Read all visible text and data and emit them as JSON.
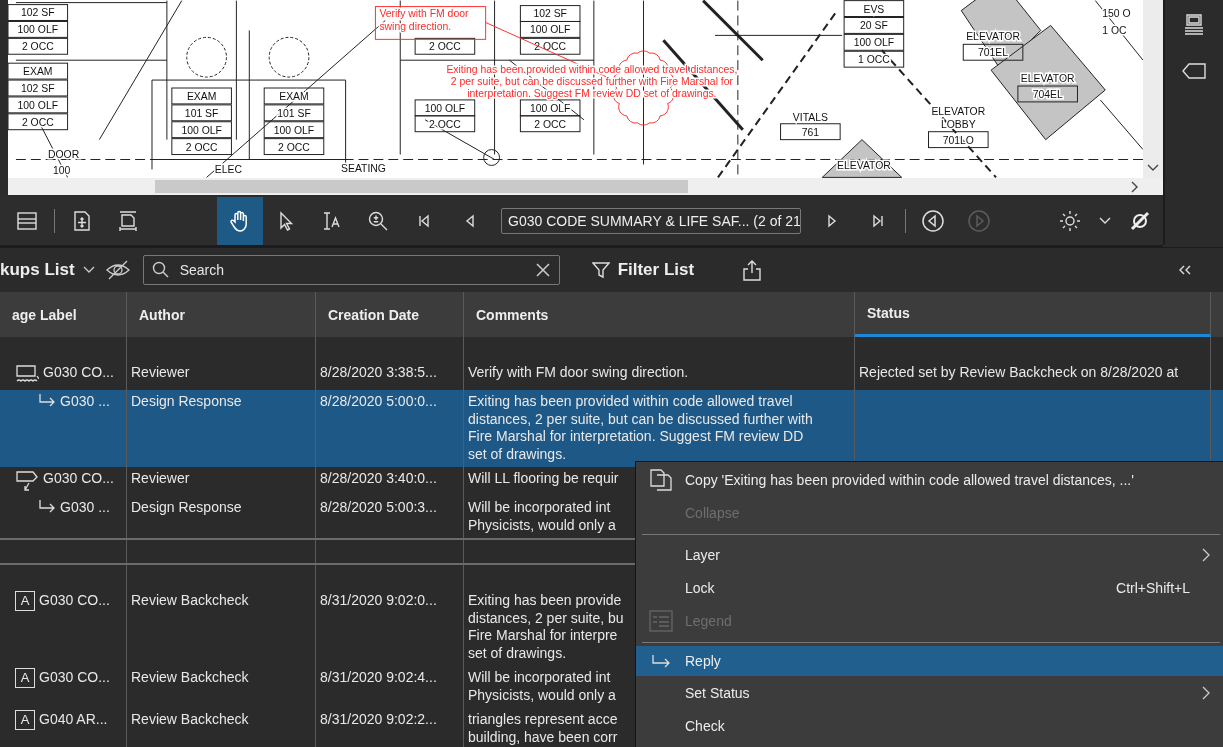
{
  "viewer": {
    "plan": {
      "labels": [
        "102 SF",
        "100 OLF",
        "2 OCC",
        "EXAM",
        "102 SF",
        "100 OLF",
        "2 OCC",
        "DOOR",
        "100",
        "EXAM",
        "101 SF",
        "100 OLF",
        "2 OCC",
        "EXAM",
        "101 SF",
        "100 OLF",
        "2 OCC",
        "ELEC",
        "SEATING",
        "2 OCC",
        "100 OLF",
        "2 OCC",
        "102 SF",
        "100 OLF",
        "2 OCC",
        "100 OLF",
        "2 OCC",
        "EVS",
        "20 SF",
        "100 OLF",
        "1 OCC",
        "VITALS",
        "761",
        "ELEVATOR",
        "701EL",
        "ELEVATOR",
        "704EL",
        "ELEVATOR",
        "LOBBY",
        "701LO",
        "ELEVATOR",
        "150 O",
        "1 OC"
      ],
      "markups": [
        {
          "kind": "box",
          "text": "Verify with FM door\nswing direction."
        },
        {
          "kind": "cloud",
          "text": "Exiting has been provided within code allowed travel distances,\n2 per suite, but can be discussed further with Fire Marshal for\ninterpretation. Suggest FM review DD set of drawings."
        }
      ]
    }
  },
  "toolbar": {
    "tools": [
      {
        "kind": "pan",
        "selected": true
      },
      {
        "kind": "select",
        "selected": false
      },
      {
        "kind": "text-select",
        "selected": false
      },
      {
        "kind": "zoom",
        "selected": false
      }
    ],
    "page_field": "G030 CODE SUMMARY & LIFE SAF... (2 of 21",
    "history": [
      {
        "kind": "back",
        "disabled": false
      },
      {
        "kind": "forward",
        "disabled": true
      }
    ]
  },
  "markups_panel": {
    "title": "kups List",
    "search": {
      "placeholder": "Search"
    },
    "filter_button": "Filter List"
  },
  "table": {
    "columns": [
      {
        "label": "age Label",
        "selected": false
      },
      {
        "label": "Author",
        "selected": false
      },
      {
        "label": "Creation Date",
        "selected": false
      },
      {
        "label": "Comments",
        "selected": false
      },
      {
        "label": "Status",
        "selected": true
      }
    ],
    "groups": [
      {
        "rows": [
          {
            "kind": "cloud",
            "page_label": "G030 CO...",
            "author": "Reviewer",
            "created": "8/28/2020 3:38:5...",
            "comment": "Verify with FM door swing direction.",
            "status": "Rejected set by Review Backcheck on 8/28/2020 at",
            "selected": false,
            "children": [
              {
                "kind": "reply",
                "page_label": "G030 ...",
                "author": "Design Response",
                "created": "8/28/2020 5:00:0...",
                "comment": "Exiting has been provided within code allowed travel\ndistances, 2 per suite, but can be discussed further with\nFire Marshal for interpretation. Suggest FM review DD\nset of drawings.",
                "selected": true
              }
            ]
          },
          {
            "kind": "callout",
            "page_label": "G030 CO...",
            "author": "Reviewer",
            "created": "8/28/2020 3:40:0...",
            "comment": "Will LL flooring be requir",
            "selected": false,
            "children": [
              {
                "kind": "reply",
                "page_label": "G030 ...",
                "author": "Design Response",
                "created": "8/28/2020 5:00:3...",
                "comment": "Will be incorporated int\nPhysicists, would only a",
                "selected": false
              }
            ]
          }
        ]
      },
      {
        "rows": [
          {
            "kind": "text",
            "icon_label": "A",
            "page_label": "G030 CO...",
            "author": "Review Backcheck",
            "created": "8/31/2020 9:02:0...",
            "comment": "Exiting has been provide\ndistances, 2 per suite, bu\nFire Marshal for interpre\nset of drawings.",
            "selected": false
          },
          {
            "kind": "text",
            "icon_label": "A",
            "page_label": "G030 CO...",
            "author": "Review Backcheck",
            "created": "8/31/2020 9:02:4...",
            "comment": "Will be incorporated int\nPhysicists, would only a",
            "selected": false
          },
          {
            "kind": "text",
            "icon_label": "A",
            "page_label": "G040 AR...",
            "author": "Review Backcheck",
            "created": "8/31/2020 9:02:2...",
            "comment": "triangles represent acce\nbuilding, have been corr",
            "selected": false
          }
        ]
      }
    ]
  },
  "context_menu": {
    "items": [
      {
        "kind": "copy",
        "label": "Copy 'Exiting has been provided within code allowed travel distances, ...'",
        "disabled": false,
        "selected": false
      },
      {
        "kind": "plain",
        "label": "Collapse",
        "disabled": true,
        "selected": false
      },
      {
        "kind": "separator"
      },
      {
        "kind": "plain",
        "label": "Layer",
        "submenu": true,
        "disabled": false,
        "selected": false
      },
      {
        "kind": "plain",
        "label": "Lock",
        "shortcut": "Ctrl+Shift+L",
        "disabled": false,
        "selected": false
      },
      {
        "kind": "legend",
        "label": "Legend",
        "disabled": true,
        "selected": false
      },
      {
        "kind": "separator"
      },
      {
        "kind": "reply",
        "label": "Reply",
        "disabled": false,
        "selected": true
      },
      {
        "kind": "plain",
        "label": "Set Status",
        "submenu": true,
        "disabled": false,
        "selected": false
      },
      {
        "kind": "plain",
        "label": "Check",
        "disabled": false,
        "selected": false
      }
    ]
  }
}
